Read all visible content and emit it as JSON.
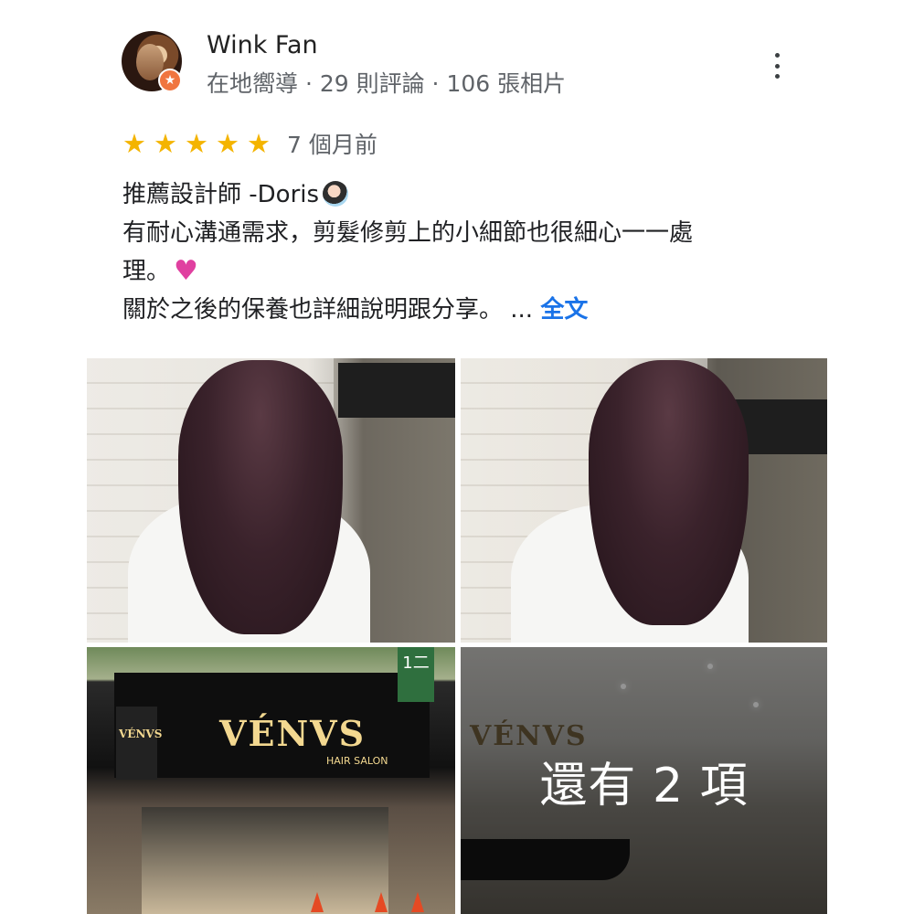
{
  "reviewer": {
    "name": "Wink Fan",
    "meta": "在地嚮導 · 29 則評論 · 106 張相片",
    "badge_icon": "local-guide-star-icon"
  },
  "rating": {
    "stars": 5,
    "max": 5,
    "time": "7 個月前",
    "star_color": "#f4b400"
  },
  "review": {
    "line1": "推薦設計師 -Doris",
    "line2": "有耐心溝通需求，剪髮修剪上的小細節也很細心一一處",
    "line3": "理。",
    "line4": "關於之後的保養也詳細說明跟分享。 ...",
    "more_label": "全文",
    "link_color": "#1a73e8"
  },
  "photos": {
    "storefront_sign": "VÉNVS",
    "storefront_sign_sub": "HAIR SALON",
    "side_sign": "VÉNVS",
    "interior_sign": "VÉNVS",
    "shop_sign_number": "1二",
    "more_overlay": "還有 2 項"
  }
}
